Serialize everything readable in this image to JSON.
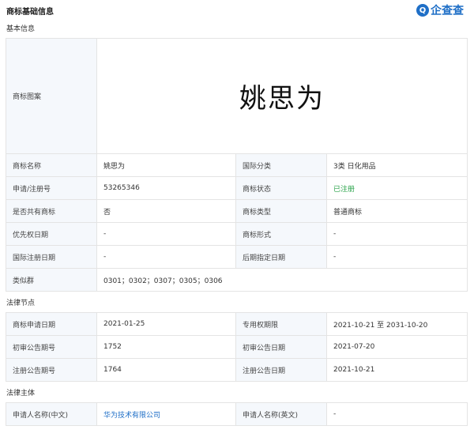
{
  "header": {
    "title": "商标基础信息",
    "logo_glyph": "Q",
    "logo_text": "企查查"
  },
  "basic": {
    "section_title": "基本信息",
    "image_label": "商标图案",
    "trademark_text": "姚思为",
    "rows": [
      [
        "商标名称",
        "姚思为",
        "国际分类",
        "3类 日化用品"
      ],
      [
        "申请/注册号",
        "53265346",
        "商标状态",
        "已注册"
      ],
      [
        "是否共有商标",
        "否",
        "商标类型",
        "普通商标"
      ],
      [
        "优先权日期",
        "-",
        "商标形式",
        "-"
      ],
      [
        "国际注册日期",
        "-",
        "后期指定日期",
        "-"
      ]
    ],
    "similar_label": "类似群",
    "similar_value": "0301；0302；0307；0305；0306"
  },
  "legal": {
    "section_title": "法律节点",
    "rows": [
      [
        "商标申请日期",
        "2021-01-25",
        "专用权期限",
        "2021-10-21 至 2031-10-20"
      ],
      [
        "初审公告期号",
        "1752",
        "初审公告日期",
        "2021-07-20"
      ],
      [
        "注册公告期号",
        "1764",
        "注册公告日期",
        "2021-10-21"
      ]
    ]
  },
  "subject": {
    "section_title": "法律主体",
    "row": [
      "申请人名称(中文)",
      "华为技术有限公司",
      "申请人名称(英文)",
      "-"
    ]
  },
  "colors": {
    "label_bg": "#f5f8fc",
    "border": "#e4e4e4",
    "status_green": "#2aa34a",
    "link_blue": "#1f6fc7"
  }
}
